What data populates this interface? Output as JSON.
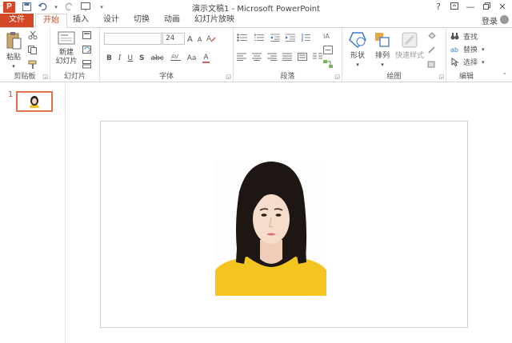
{
  "window": {
    "title": "演示文稿1 - Microsoft PowerPoint",
    "app_logo": "P",
    "help": "?",
    "login": "登录"
  },
  "tabs": [
    {
      "label": "文件"
    },
    {
      "label": "开始"
    },
    {
      "label": "插入"
    },
    {
      "label": "设计"
    },
    {
      "label": "切换"
    },
    {
      "label": "动画"
    },
    {
      "label": "幻灯片放映"
    }
  ],
  "ribbon": {
    "clipboard": {
      "label": "剪贴板",
      "paste": "粘贴"
    },
    "slides": {
      "label": "幻灯片",
      "new_slide_line1": "新建",
      "new_slide_line2": "幻灯片"
    },
    "font": {
      "label": "字体",
      "font_name": "",
      "font_size": "24",
      "bold": "B",
      "italic": "I",
      "underline": "U",
      "strike": "S",
      "spacing": "abc",
      "case": "Aa",
      "color": "A",
      "grow": "A",
      "shrink": "A"
    },
    "paragraph": {
      "label": "段落"
    },
    "drawing": {
      "label": "绘图",
      "shapes": "形状",
      "arrange": "排列",
      "quick_styles": "快速样式"
    },
    "editing": {
      "label": "编辑",
      "find": "查找",
      "replace": "替换",
      "select": "选择"
    }
  },
  "sidebar": {
    "slide_number": "1"
  },
  "colors": {
    "accent": "#d24726",
    "thumb_border": "#e0724d",
    "shirt": "#f4c51f"
  }
}
